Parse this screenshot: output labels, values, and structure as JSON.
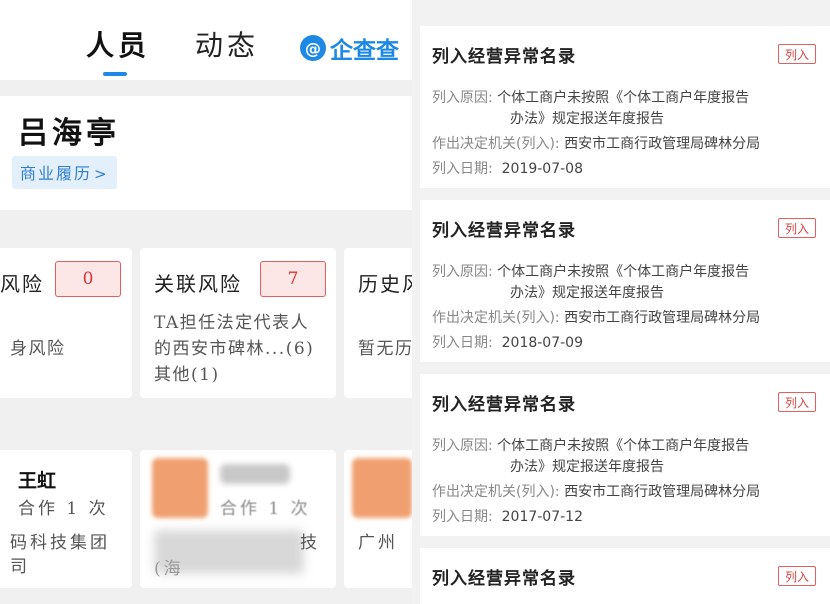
{
  "left": {
    "tabs": {
      "people": "人员",
      "dynamics": "动态"
    },
    "logo": {
      "mark": "@",
      "text": "企查查"
    },
    "profile": {
      "name": "吕海亭",
      "history_link": "商业履历",
      "history_chevron": ">"
    },
    "risk_cards": [
      {
        "title": "风险",
        "count": "0",
        "desc": "身风险"
      },
      {
        "title": "关联风险",
        "count": "7",
        "desc_lines": [
          "TA担任法定代表人",
          "的西安市碑林...(6)",
          "其他(1)"
        ]
      },
      {
        "title": "历史风",
        "desc": "暂无历"
      }
    ],
    "partners": [
      {
        "name": "王虹",
        "coop": "合作 1 次",
        "company_lines": [
          "码科技集团",
          "司"
        ]
      },
      {
        "coop": "合作 1 次",
        "company_lines": [
          "技",
          "(海"
        ]
      },
      {
        "company_lines": [
          "广州"
        ]
      }
    ],
    "colors": {
      "accent": "#1e88e5",
      "risk_red": "#d33",
      "blur_orange": "#f0a070"
    }
  },
  "records": [
    {
      "title": "列入经营异常名录",
      "tag": "列入",
      "reason_label": "列入原因:",
      "reason_lines": [
        "个体工商户未按照《个体工商户年度报告",
        "办法》规定报送年度报告"
      ],
      "authority_label": "作出决定机关(列入):",
      "authority": "西安市工商行政管理局碑林分局",
      "date_label": "列入日期:",
      "date": "2019-07-08"
    },
    {
      "title": "列入经营异常名录",
      "tag": "列入",
      "reason_label": "列入原因:",
      "reason_lines": [
        "个体工商户未按照《个体工商户年度报告",
        "办法》规定报送年度报告"
      ],
      "authority_label": "作出决定机关(列入):",
      "authority": "西安市工商行政管理局碑林分局",
      "date_label": "列入日期:",
      "date": "2018-07-09"
    },
    {
      "title": "列入经营异常名录",
      "tag": "列入",
      "reason_label": "列入原因:",
      "reason_lines": [
        "个体工商户未按照《个体工商户年度报告",
        "办法》规定报送年度报告"
      ],
      "authority_label": "作出决定机关(列入):",
      "authority": "西安市工商行政管理局碑林分局",
      "date_label": "列入日期:",
      "date": "2017-07-12"
    },
    {
      "title": "列入经营异常名录",
      "tag": "列入"
    }
  ]
}
